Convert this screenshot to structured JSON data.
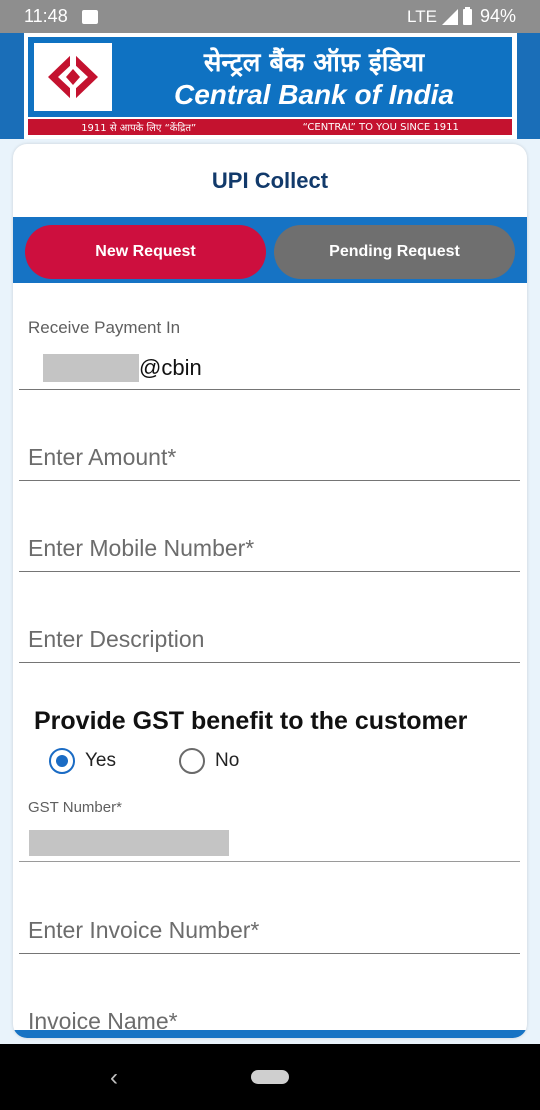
{
  "status_bar": {
    "time": "11:48",
    "network": "LTE",
    "battery": "94%"
  },
  "banner": {
    "hindi_name": "सेन्ट्रल बैंक ऑफ़ इंडिया",
    "english_name": "Central Bank of India",
    "tagline_hindi": "1911 से आपके लिए “केंद्रित”",
    "tagline_english": "“CENTRAL” TO YOU SINCE 1911",
    "colors": {
      "blue": "#0f72c2",
      "red": "#c4122f"
    }
  },
  "page": {
    "title": "UPI Collect"
  },
  "tabs": [
    {
      "label": "New Request",
      "active": true
    },
    {
      "label": "Pending Request",
      "active": false
    }
  ],
  "form": {
    "receive_label": "Receive Payment In",
    "upi_suffix": "@cbin",
    "amount_placeholder": "Enter Amount*",
    "mobile_placeholder": "Enter Mobile Number*",
    "description_placeholder": "Enter Description",
    "gst_heading": "Provide GST benefit to the customer",
    "gst_yes": "Yes",
    "gst_no": "No",
    "gst_selected": "Yes",
    "gst_number_label": "GST Number*",
    "invoice_number_placeholder": "Enter Invoice Number*",
    "invoice_name_placeholder": "Invoice Name*"
  }
}
